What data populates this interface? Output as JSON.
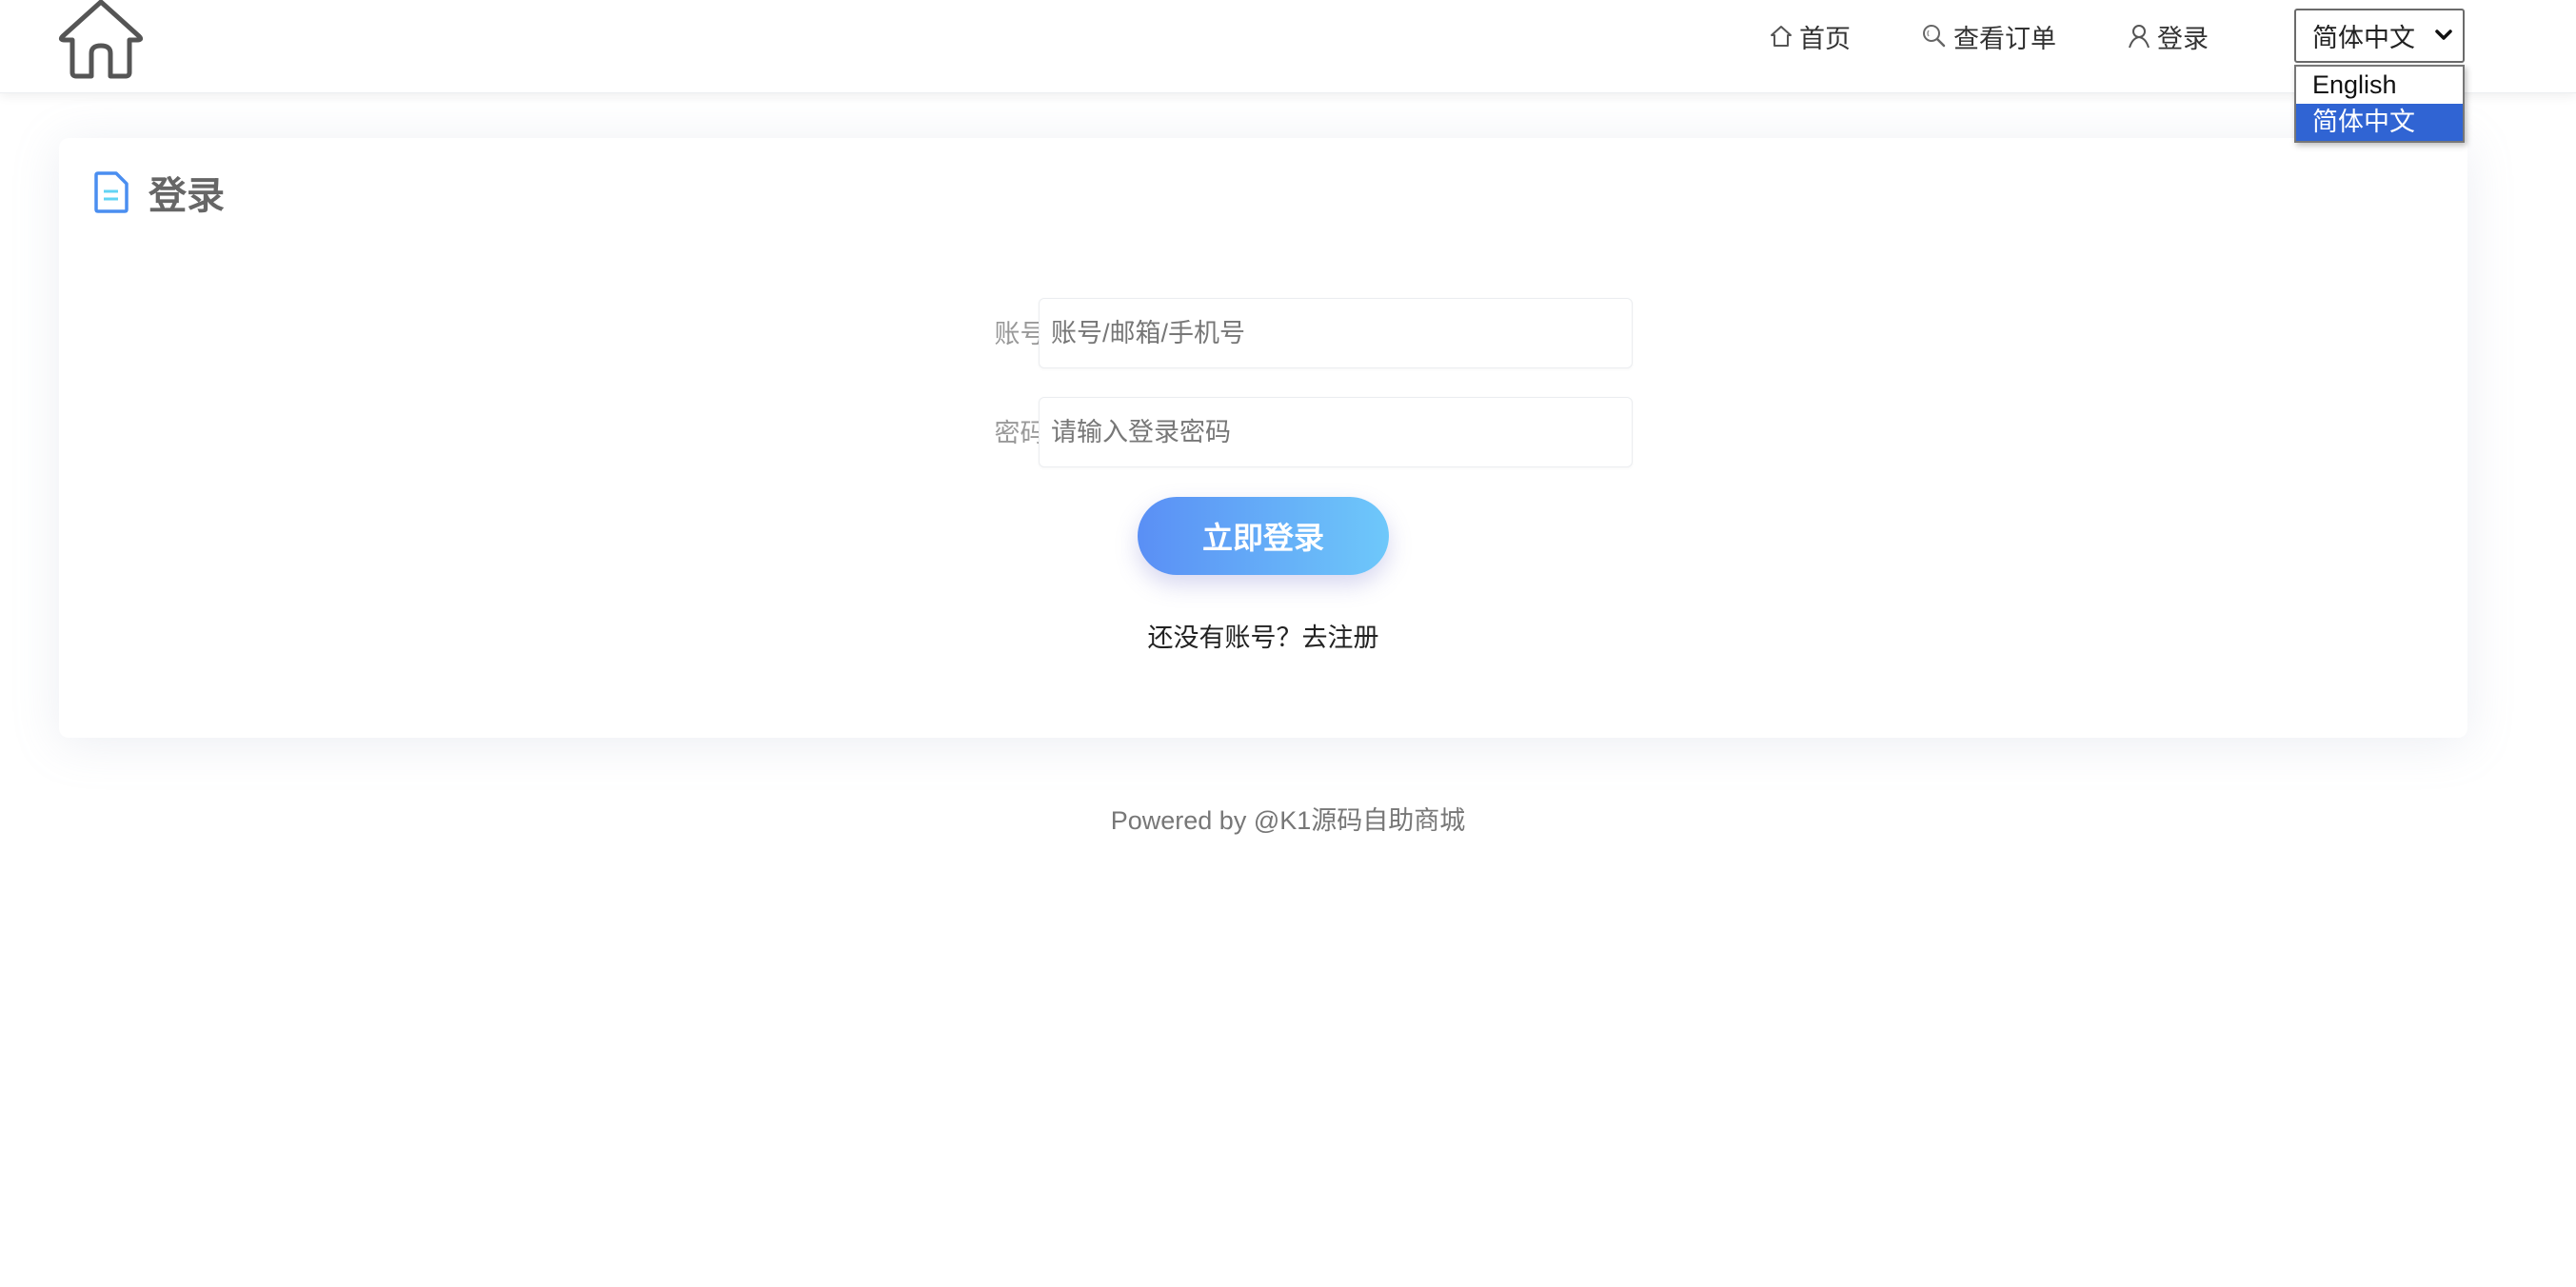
{
  "header": {
    "logo_icon": "home-outline-icon",
    "nav": [
      {
        "label": "首页",
        "icon": "home-icon"
      },
      {
        "label": "查看订单",
        "icon": "search-icon"
      },
      {
        "label": "登录",
        "icon": "user-icon"
      }
    ],
    "language": {
      "selected": "简体中文",
      "options": [
        "English",
        "简体中文"
      ],
      "highlighted_option": "简体中文"
    }
  },
  "card": {
    "title": "登录",
    "title_icon": "document-icon",
    "form": {
      "account_label": "账号:",
      "account_placeholder": "账号/邮箱/手机号",
      "account_value": "",
      "password_label": "密码:",
      "password_placeholder": "请输入登录密码",
      "password_value": ""
    },
    "login_button": "立即登录",
    "register_prompt": "还没有账号？",
    "register_link": "去注册"
  },
  "footer": {
    "text": "Powered by @K1源码自助商城"
  },
  "colors": {
    "accent_gradient_start": "#5a8ff5",
    "accent_gradient_end": "#6ec8fa",
    "dropdown_highlight": "#3064d3",
    "title_icon": "#4a8ef0"
  }
}
